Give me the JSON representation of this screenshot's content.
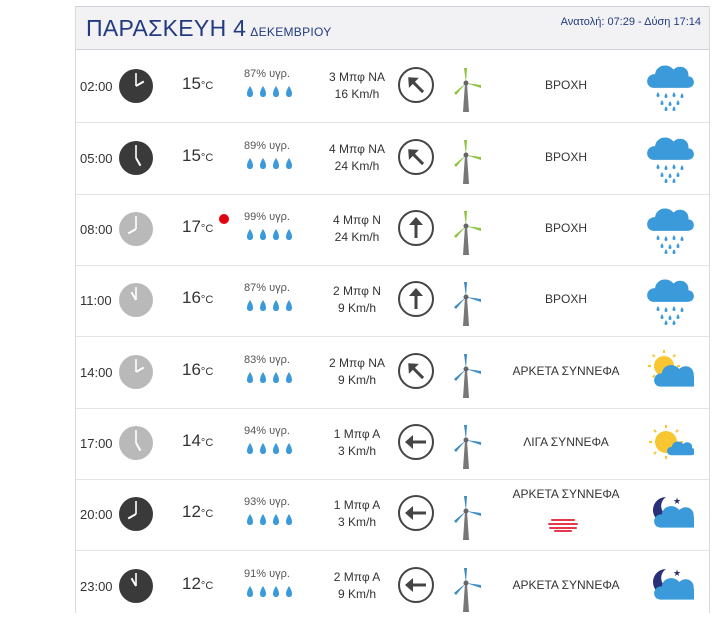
{
  "header": {
    "day": "ΠΑΡΑΣΚΕΥΗ 4",
    "month": "ΔΕΚΕΜΒΡΙΟΥ",
    "sun": "Ανατολή: 07:29 - Δύση 17:14"
  },
  "units": {
    "celsius": "°C"
  },
  "colors": {
    "title": "#233a80",
    "rain_icon": "#3b9ad9",
    "sun": "#f7c630",
    "moon": "#2a2f78",
    "turbine_green": "#8cc43f",
    "turbine_blue": "#3b8cc4",
    "alert": "#e3000f"
  },
  "rows": [
    {
      "time": "02:00",
      "clock": "dark",
      "temp": "15",
      "humidity": "87% υγρ.",
      "wind_force": "3 Μπφ ΝΑ",
      "wind_speed": "16 Km/h",
      "wind_dir": "north-west-arrow",
      "turbine": "green",
      "condition": "ΒΡΟΧΗ",
      "icon": "rain-icon",
      "alert": false
    },
    {
      "time": "05:00",
      "clock": "dark",
      "temp": "15",
      "humidity": "89% υγρ.",
      "wind_force": "4 Μπφ ΝΑ",
      "wind_speed": "24 Km/h",
      "wind_dir": "north-west-arrow",
      "turbine": "green",
      "condition": "ΒΡΟΧΗ",
      "icon": "rain-icon",
      "alert": false
    },
    {
      "time": "08:00",
      "clock": "light",
      "temp": "17",
      "humidity": "99% υγρ.",
      "wind_force": "4 Μπφ Ν",
      "wind_speed": "24 Km/h",
      "wind_dir": "north-arrow",
      "turbine": "green",
      "condition": "ΒΡΟΧΗ",
      "icon": "rain-icon",
      "alert": true
    },
    {
      "time": "11:00",
      "clock": "light",
      "temp": "16",
      "humidity": "87% υγρ.",
      "wind_force": "2 Μπφ Ν",
      "wind_speed": "9 Km/h",
      "wind_dir": "north-arrow",
      "turbine": "blue",
      "condition": "ΒΡΟΧΗ",
      "icon": "rain-icon",
      "alert": false
    },
    {
      "time": "14:00",
      "clock": "light",
      "temp": "16",
      "humidity": "83% υγρ.",
      "wind_force": "2 Μπφ ΝΑ",
      "wind_speed": "9 Km/h",
      "wind_dir": "north-west-arrow",
      "turbine": "blue",
      "condition": "ΑΡΚΕΤΑ ΣΥΝΝΕΦΑ",
      "icon": "sun-cloud-icon",
      "alert": false
    },
    {
      "time": "17:00",
      "clock": "light",
      "temp": "14",
      "humidity": "94% υγρ.",
      "wind_force": "1 Μπφ Α",
      "wind_speed": "3 Km/h",
      "wind_dir": "west-arrow",
      "turbine": "blue",
      "condition": "ΛΙΓΑ ΣΥΝΝΕΦΑ",
      "icon": "sun-small-cloud-icon",
      "alert": false
    },
    {
      "time": "20:00",
      "clock": "dark",
      "temp": "12",
      "humidity": "93% υγρ.",
      "wind_force": "1 Μπφ Α",
      "wind_speed": "3 Km/h",
      "wind_dir": "west-arrow",
      "turbine": "blue",
      "condition": "ΑΡΚΕΤΑ ΣΥΝΝΕΦΑ",
      "icon": "moon-cloud-icon",
      "alert": false,
      "fog": true
    },
    {
      "time": "23:00",
      "clock": "dark",
      "temp": "12",
      "humidity": "91% υγρ.",
      "wind_force": "2 Μπφ Α",
      "wind_speed": "9 Km/h",
      "wind_dir": "west-arrow",
      "turbine": "blue",
      "condition": "ΑΡΚΕΤΑ ΣΥΝΝΕΦΑ",
      "icon": "moon-cloud-icon",
      "alert": false
    }
  ]
}
